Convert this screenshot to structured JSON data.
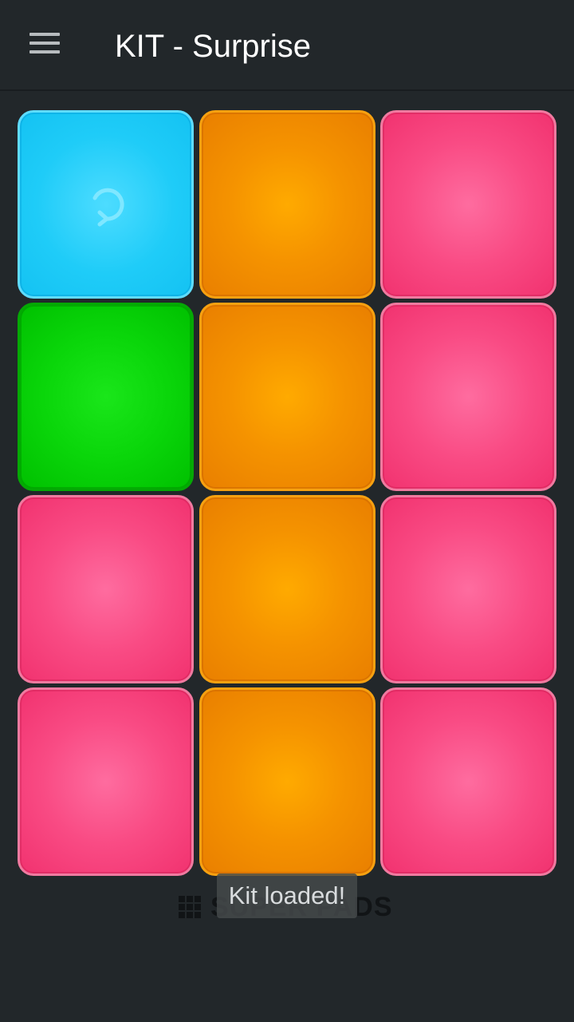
{
  "header": {
    "title": "KIT - Surprise",
    "menu_icon": "hamburger-menu-icon"
  },
  "pads": [
    {
      "row": 1,
      "col": 1,
      "color": "cyan",
      "hex": "#1fccf8",
      "icon": "refresh-icon"
    },
    {
      "row": 1,
      "col": 2,
      "color": "orange",
      "hex": "#f59300"
    },
    {
      "row": 1,
      "col": 3,
      "color": "pink",
      "hex": "#f94b84"
    },
    {
      "row": 2,
      "col": 1,
      "color": "green",
      "hex": "#0ad60a"
    },
    {
      "row": 2,
      "col": 2,
      "color": "orange",
      "hex": "#f59300"
    },
    {
      "row": 2,
      "col": 3,
      "color": "pink",
      "hex": "#f94b84"
    },
    {
      "row": 3,
      "col": 1,
      "color": "pink",
      "hex": "#f94b84"
    },
    {
      "row": 3,
      "col": 2,
      "color": "orange",
      "hex": "#f59300"
    },
    {
      "row": 3,
      "col": 3,
      "color": "pink",
      "hex": "#f94b84"
    },
    {
      "row": 4,
      "col": 1,
      "color": "pink",
      "hex": "#f94b84"
    },
    {
      "row": 4,
      "col": 2,
      "color": "orange",
      "hex": "#f59300"
    },
    {
      "row": 4,
      "col": 3,
      "color": "pink",
      "hex": "#f94b84"
    }
  ],
  "brand": {
    "text": "SUPER PADS",
    "icon": "grid-logo-icon"
  },
  "toast": {
    "message": "Kit loaded!"
  },
  "colors": {
    "background": "#22272a",
    "title_text": "#ffffff"
  }
}
